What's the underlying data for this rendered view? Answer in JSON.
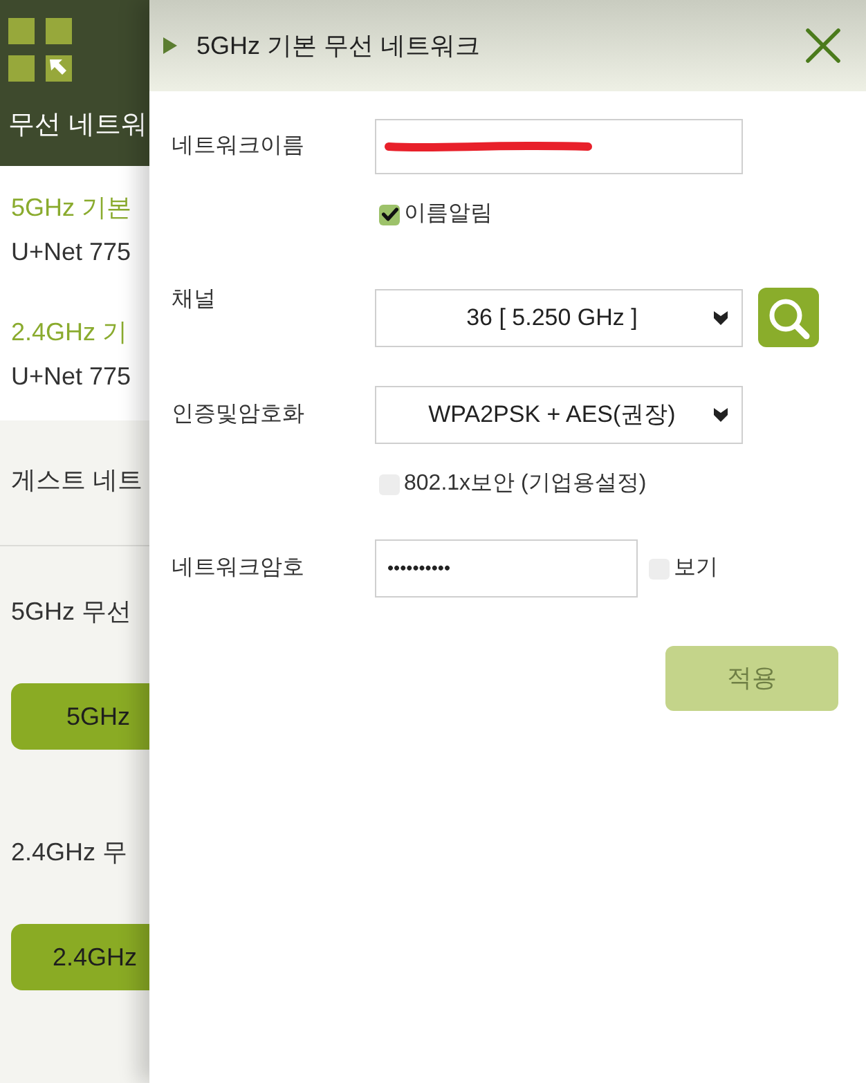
{
  "background_page": {
    "header": {
      "title": "무선 네트워"
    },
    "networks": [
      {
        "band": "5GHz 기본",
        "ssid": "U+Net 775"
      },
      {
        "band": "2.4GHz 기",
        "ssid": "U+Net 775"
      }
    ],
    "guest_network": {
      "title": "게스트 네트"
    },
    "radio_sections": [
      {
        "label": "5GHz 무선",
        "button": "5GHz"
      },
      {
        "label": "2.4GHz 무",
        "button": "2.4GHz"
      }
    ]
  },
  "dialog": {
    "title": "5GHz 기본 무선 네트워크",
    "fields": [
      {
        "kind": "text",
        "label": "네트워크이름",
        "redacted": true,
        "checkbox": {
          "label": "이름알림",
          "checked": true
        }
      },
      {
        "kind": "select",
        "label": "채널",
        "value": "36 [ 5.250 GHz ]",
        "search_button": true
      },
      {
        "kind": "select",
        "label": "인증및암호화",
        "value": "WPA2PSK + AES(권장)",
        "checkbox": {
          "label": "802.1x보안 (기업용설정)",
          "checked": false
        }
      },
      {
        "kind": "password",
        "label": "네트워크암호",
        "value": "••••••••••",
        "show_toggle": {
          "label": "보기",
          "checked": false
        }
      }
    ],
    "apply_button": {
      "label": "적용",
      "disabled": true
    }
  }
}
